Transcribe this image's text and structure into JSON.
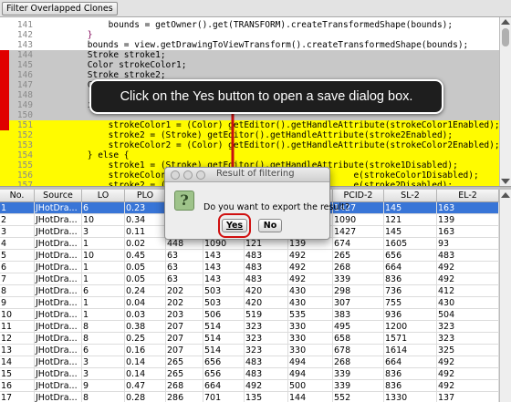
{
  "toolbar": {
    "filter_label": "Filter Overlapped Clones"
  },
  "editor": {
    "lines": [
      {
        "num": "141",
        "text": "            bounds = getOwner().get(TRANSFORM).createTransformedShape(bounds);",
        "style": "plain",
        "mark": false
      },
      {
        "num": "142",
        "text": "        }",
        "style": "kw",
        "mark": false
      },
      {
        "num": "143",
        "text": "        bounds = view.getDrawingToViewTransform().createTransformedShape(bounds);",
        "style": "plain",
        "mark": false
      },
      {
        "num": "144",
        "text": "        Stroke stroke1;",
        "style": "gray",
        "mark": true
      },
      {
        "num": "145",
        "text": "        Color strokeColor1;",
        "style": "gray",
        "mark": true
      },
      {
        "num": "146",
        "text": "        Stroke stroke2;",
        "style": "gray",
        "mark": true
      },
      {
        "num": "147",
        "text": "        Color strokeColor2;",
        "style": "gray",
        "mark": true
      },
      {
        "num": "148",
        "text": "",
        "style": "gray",
        "mark": true
      },
      {
        "num": "149",
        "text": "        if (g",
        "style": "gray",
        "mark": true
      },
      {
        "num": "150",
        "text": "",
        "style": "gray",
        "mark": true
      },
      {
        "num": "151",
        "text": "            strokeColor1 = (Color) getEditor().getHandleAttribute(strokeColor1Enabled);",
        "style": "yellow",
        "mark": true
      },
      {
        "num": "152",
        "text": "            stroke2 = (Stroke) getEditor().getHandleAttribute(stroke2Enabled);",
        "style": "yellow",
        "mark": false
      },
      {
        "num": "153",
        "text": "            strokeColor2 = (Color) getEditor().getHandleAttribute(strokeColor2Enabled);",
        "style": "yellow",
        "mark": false
      },
      {
        "num": "154",
        "text": "        } else {",
        "style": "yellow",
        "mark": false
      },
      {
        "num": "155",
        "text": "            stroke1 = (Stroke) getEditor().getHandleAttribute(stroke1Disabled);",
        "style": "yellow",
        "mark": false
      },
      {
        "num": "156",
        "text": "            strokeColor1 = (C                              e(strokeColor1Disabled);",
        "style": "yellow",
        "mark": false
      },
      {
        "num": "157",
        "text": "            stroke2 = (Stroke                              e(stroke2Disabled);",
        "style": "yellow",
        "mark": false
      }
    ]
  },
  "callout": {
    "text": "Click on the Yes button to open a save dialog box."
  },
  "dialog": {
    "title": "Result of filtering",
    "message": "Do you want to export the result?",
    "icon": "question-icon",
    "yes_label": "Yes",
    "no_label": "No"
  },
  "table": {
    "columns": [
      "No.",
      "Source",
      "LO",
      "PLO",
      "",
      "",
      "",
      "CCID-2",
      "PCID-2",
      "SL-2",
      "EL-2"
    ],
    "rows": [
      [
        "1",
        "JHotDra...",
        "6",
        "0.23",
        "",
        "",
        "",
        "674",
        "1427",
        "145",
        "163"
      ],
      [
        "2",
        "JHotDra...",
        "10",
        "0.34",
        "",
        "",
        "",
        "118",
        "1090",
        "121",
        "139"
      ],
      [
        "3",
        "JHotDra...",
        "3",
        "0.11",
        "",
        "",
        "",
        "674",
        "1427",
        "145",
        "163"
      ],
      [
        "4",
        "JHotDra...",
        "1",
        "0.02",
        "448",
        "1090",
        "121",
        "139",
        "674",
        "1605",
        "93",
        "121"
      ],
      [
        "5",
        "JHotDra...",
        "10",
        "0.45",
        "63",
        "143",
        "483",
        "492",
        "265",
        "656",
        "483",
        "494"
      ],
      [
        "6",
        "JHotDra...",
        "1",
        "0.05",
        "63",
        "143",
        "483",
        "492",
        "268",
        "664",
        "492",
        "500"
      ],
      [
        "7",
        "JHotDra...",
        "1",
        "0.05",
        "63",
        "143",
        "483",
        "492",
        "339",
        "836",
        "492",
        "501"
      ],
      [
        "8",
        "JHotDra...",
        "6",
        "0.24",
        "202",
        "503",
        "420",
        "430",
        "298",
        "736",
        "412",
        "425"
      ],
      [
        "9",
        "JHotDra...",
        "1",
        "0.04",
        "202",
        "503",
        "420",
        "430",
        "307",
        "755",
        "430",
        "442"
      ],
      [
        "10",
        "JHotDra...",
        "1",
        "0.03",
        "203",
        "506",
        "519",
        "535",
        "383",
        "936",
        "504",
        "519"
      ],
      [
        "11",
        "JHotDra...",
        "8",
        "0.38",
        "207",
        "514",
        "323",
        "330",
        "495",
        "1200",
        "323",
        "335"
      ],
      [
        "12",
        "JHotDra...",
        "8",
        "0.25",
        "207",
        "514",
        "323",
        "330",
        "658",
        "1571",
        "323",
        "346"
      ],
      [
        "13",
        "JHotDra...",
        "6",
        "0.16",
        "207",
        "514",
        "323",
        "330",
        "678",
        "1614",
        "325",
        "354"
      ],
      [
        "14",
        "JHotDra...",
        "3",
        "0.14",
        "265",
        "656",
        "483",
        "494",
        "268",
        "664",
        "492",
        "500"
      ],
      [
        "15",
        "JHotDra...",
        "3",
        "0.14",
        "265",
        "656",
        "483",
        "494",
        "339",
        "836",
        "492",
        "501"
      ],
      [
        "16",
        "JHotDra...",
        "9",
        "0.47",
        "268",
        "664",
        "492",
        "500",
        "339",
        "836",
        "492",
        "501"
      ],
      [
        "17",
        "JHotDra...",
        "8",
        "0.28",
        "286",
        "701",
        "135",
        "144",
        "552",
        "1330",
        "137",
        "155"
      ]
    ]
  },
  "colors": {
    "selection": "#3875d7",
    "highlight_yellow": "#fffb00",
    "highlight_gray": "#c8c8c8",
    "gutter_mark": "#e00000",
    "callout_bg": "#1e1e1e",
    "arrow": "#c81010"
  }
}
